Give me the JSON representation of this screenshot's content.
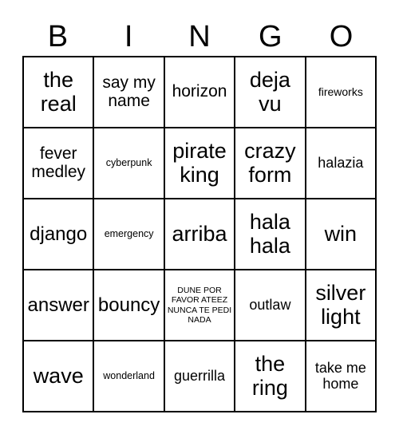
{
  "card": {
    "header_letters": [
      "B",
      "I",
      "N",
      "G",
      "O"
    ],
    "rows": [
      [
        {
          "text": "the real",
          "size": "fs-xxl"
        },
        {
          "text": "say my name",
          "size": "fs-l"
        },
        {
          "text": "horizon",
          "size": "fs-l"
        },
        {
          "text": "deja vu",
          "size": "fs-xxl"
        },
        {
          "text": "fireworks",
          "size": "fs-s"
        }
      ],
      [
        {
          "text": "fever medley",
          "size": "fs-l"
        },
        {
          "text": "cyberpunk",
          "size": "fs-xs"
        },
        {
          "text": "pirate king",
          "size": "fs-xxl"
        },
        {
          "text": "crazy form",
          "size": "fs-xxl"
        },
        {
          "text": "halazia",
          "size": "fs-m"
        }
      ],
      [
        {
          "text": "django",
          "size": "fs-xl"
        },
        {
          "text": "emergency",
          "size": "fs-xs"
        },
        {
          "text": "arriba",
          "size": "fs-xxl"
        },
        {
          "text": "hala hala",
          "size": "fs-xxl"
        },
        {
          "text": "win",
          "size": "fs-xxl"
        }
      ],
      [
        {
          "text": "answer",
          "size": "fs-xl"
        },
        {
          "text": "bouncy",
          "size": "fs-xl"
        },
        {
          "text": "DUNE POR FAVOR ATEEZ NUNCA TE PEDI NADA",
          "size": "fs-tiny"
        },
        {
          "text": "outlaw",
          "size": "fs-m"
        },
        {
          "text": "silver light",
          "size": "fs-xxl"
        }
      ],
      [
        {
          "text": "wave",
          "size": "fs-xxl"
        },
        {
          "text": "wonderland",
          "size": "fs-xs"
        },
        {
          "text": "guerrilla",
          "size": "fs-m"
        },
        {
          "text": "the ring",
          "size": "fs-xxl"
        },
        {
          "text": "take me home",
          "size": "fs-m"
        }
      ]
    ]
  },
  "colors": {
    "border": "#000000",
    "text": "#000000",
    "background": "#ffffff"
  }
}
